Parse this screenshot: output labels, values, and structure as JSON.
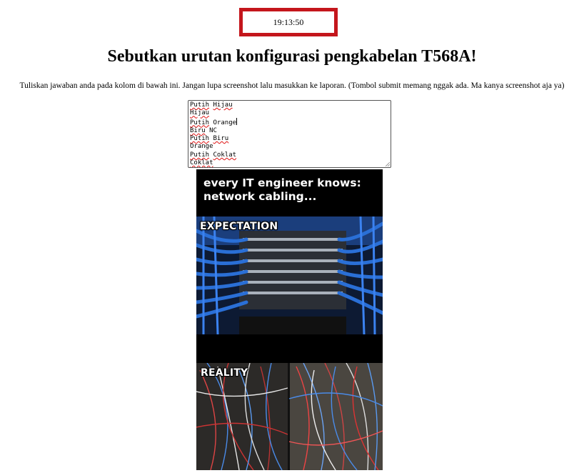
{
  "clock": {
    "time": "19:13:50",
    "border_color": "#c4161c"
  },
  "heading": "Sebutkan urutan konfigurasi pengkabelan T568A!",
  "instructions": "Tuliskan jawaban anda pada kolom di bawah ini. Jangan lupa screenshot lalu masukkan ke laporan. (Tombol submit memang nggak ada. Ma kanya screenshot aja ya)",
  "answer_lines": [
    "Putih Hijau",
    "Hijau",
    "Putih Orange",
    "Biru NC",
    "Putih Biru",
    "Orange",
    "Putih Coklat",
    "Coklat"
  ],
  "meme": {
    "header_line1": "every IT engineer knows:",
    "header_line2": "network cabling...",
    "label_expectation": "EXPECTATION",
    "label_reality": "REALITY",
    "cable_color": "#2a6fd6"
  }
}
